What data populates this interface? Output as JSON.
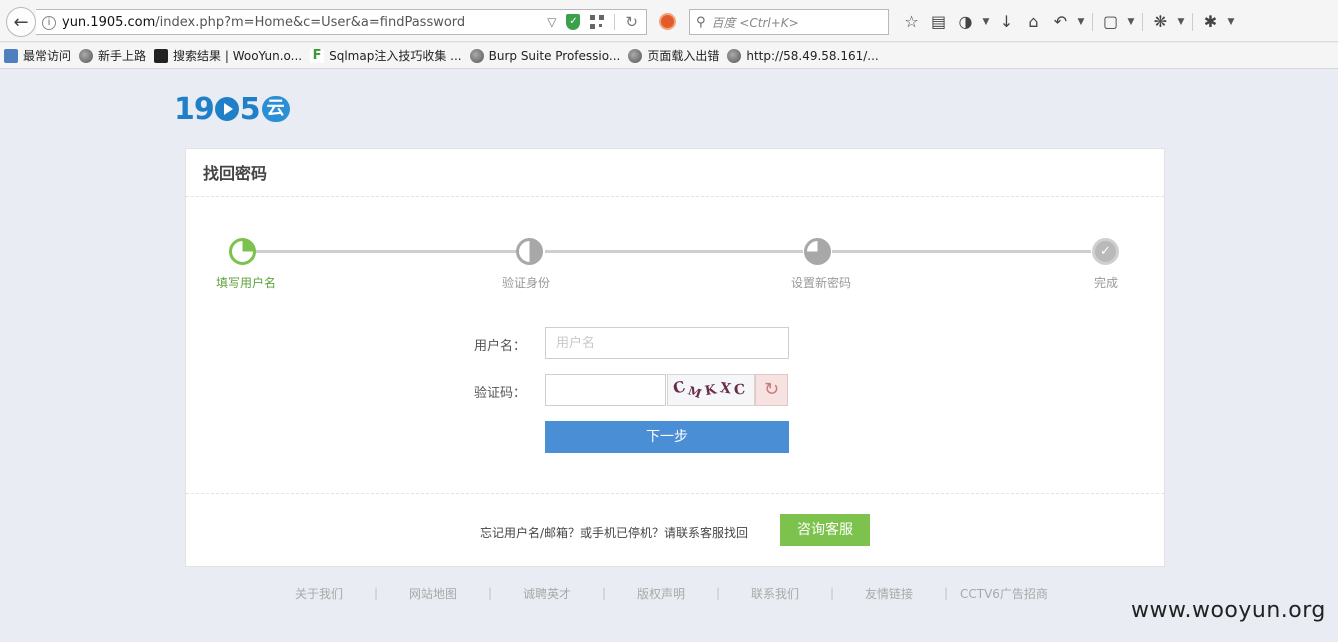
{
  "browser": {
    "url_host": "yun.1905.com",
    "url_path": "/index.php?m=Home&c=User&a=findPassword",
    "search_placeholder": "百度 <Ctrl+K>",
    "bookmarks": [
      {
        "label": "最常访问",
        "icon": "star-folder-icon"
      },
      {
        "label": "新手上路",
        "icon": "globe-icon"
      },
      {
        "label": "搜索结果 | WooYun.o...",
        "icon": "wooyun-icon"
      },
      {
        "label": "Sqlmap注入技巧收集 ...",
        "icon": "f-icon"
      },
      {
        "label": "Burp Suite Professio...",
        "icon": "globe-icon"
      },
      {
        "label": "页面载入出错",
        "icon": "globe-icon"
      },
      {
        "label": "http://58.49.58.161/...",
        "icon": "globe-icon"
      }
    ]
  },
  "logo": {
    "text_a": "19",
    "text_b": "5",
    "cloud": "云"
  },
  "card": {
    "title": "找回密码",
    "steps": [
      {
        "label": "填写用户名",
        "state": "active"
      },
      {
        "label": "验证身份",
        "state": "pending"
      },
      {
        "label": "设置新密码",
        "state": "pending"
      },
      {
        "label": "完成",
        "state": "pending"
      }
    ],
    "form": {
      "username_label": "用户名：",
      "username_placeholder": "用户名",
      "captcha_label": "验证码：",
      "captcha_value": "",
      "captcha_chars": [
        "C",
        "M",
        "K",
        "X",
        "C"
      ],
      "next_label": "下一步"
    },
    "footer": {
      "help_text": "忘记用户名/邮箱？或手机已停机？请联系客服找回",
      "consult_label": "咨询客服"
    }
  },
  "footer_links": [
    "关于我们",
    "网站地图",
    "诚聘英才",
    "版权声明",
    "联系我们",
    "友情链接",
    "CCTV6广告招商"
  ],
  "watermark": "www.wooyun.org",
  "colors": {
    "primary": "#4a8fd6",
    "green": "#7cc24c",
    "brand": "#1f7fc7"
  }
}
